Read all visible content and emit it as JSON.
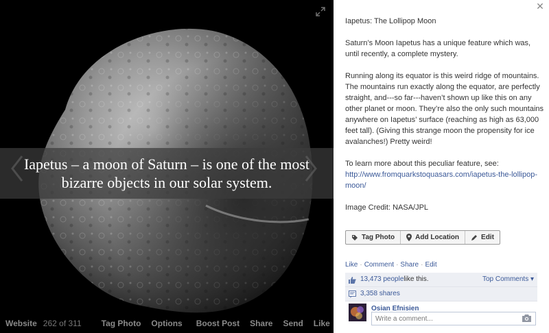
{
  "photo": {
    "caption": "Iapetus – a moon of Saturn – is one of the most bizarre objects in our solar system.",
    "icons": {
      "expand": "expand-icon",
      "prev": "chevron-left-icon",
      "next": "chevron-right-icon"
    }
  },
  "photo_bar": {
    "website": "Website",
    "counter": "262 of 311",
    "tag_photo": "Tag Photo",
    "options": "Options",
    "boost_post": "Boost Post",
    "share": "Share",
    "send": "Send",
    "like": "Like"
  },
  "description": {
    "title": "Iapetus: The Lollipop Moon",
    "para1": "Saturn’s Moon Iapetus has a unique feature which was, until recently, a complete mystery.",
    "para2": "Running along its equator is this weird ridge of mountains. The mountains run exactly along the equator, are perfectly straight, and---so far---haven’t shown up like this on any other planet or moon. They’re also the only such mountains anywhere on Iapetus’ surface (reaching as high as 63,000 feet tall). (Giving this strange moon the propensity for ice avalanches!) Pretty weird!",
    "para3_prefix": "To learn more about this peculiar feature, see: ",
    "link": "http://www.fromquarkstoquasars.com/iapetus-the-lollipop-moon/",
    "credit": "Image Credit: NASA/JPL"
  },
  "tag_buttons": {
    "tag_photo": "Tag Photo",
    "add_location": "Add Location",
    "edit": "Edit"
  },
  "actions": {
    "like": "Like",
    "comment": "Comment",
    "share": "Share",
    "edit": "Edit"
  },
  "stats": {
    "likes_count": "13,473 people",
    "likes_suffix": " like this.",
    "top_comments": "Top Comments ▾",
    "shares": "3,358 shares"
  },
  "comment": {
    "commenter_name": "Osian Efnisien",
    "placeholder": "Write a comment..."
  },
  "colors": {
    "link": "#3b5998",
    "panel": "#edeff4",
    "stage": "#000000"
  }
}
